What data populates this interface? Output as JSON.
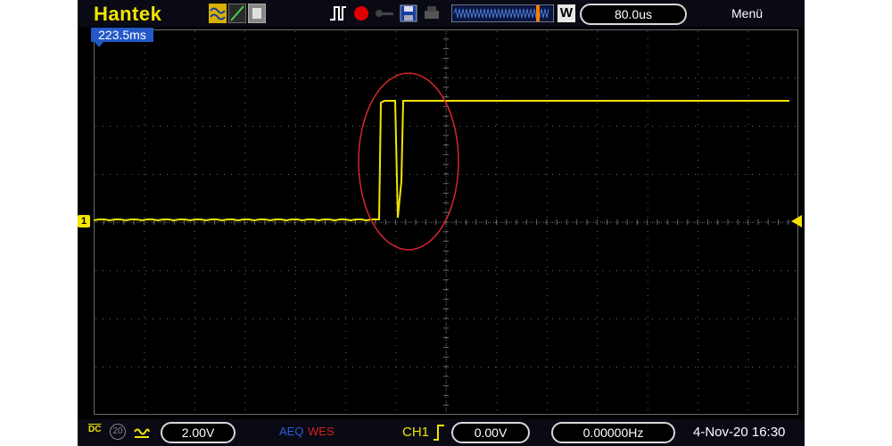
{
  "header": {
    "brand": "Hantek",
    "timebase": "80.0us",
    "window_badge": "W",
    "menu_label": "Menü",
    "mode_icons": [
      "dots-mode-icon",
      "vectors-mode-icon",
      "persist-mode-icon"
    ],
    "run_icons": [
      "trigger-pulse-icon",
      "record-icon",
      "key-icon",
      "save-icon",
      "print-icon"
    ]
  },
  "trigger_position_tag": "223.5ms",
  "footer": {
    "coupling": "DC",
    "bw_limit": "20",
    "ch1_scale": "2.00V",
    "acq_label_1": "AEQ",
    "acq_label_2": "WES",
    "trigger_source": "CH1",
    "trigger_level": "0.00V",
    "frequency": "0.00000Hz",
    "datetime": "4-Nov-20 16:30"
  },
  "channel_marker": "1",
  "colors": {
    "trace": "#f2e400",
    "annotation": "#d8262c",
    "grid": "#6a6a6a",
    "brand": "#f2e400"
  },
  "annotation": {
    "shape": "ellipse",
    "label": "circled glitch"
  }
}
